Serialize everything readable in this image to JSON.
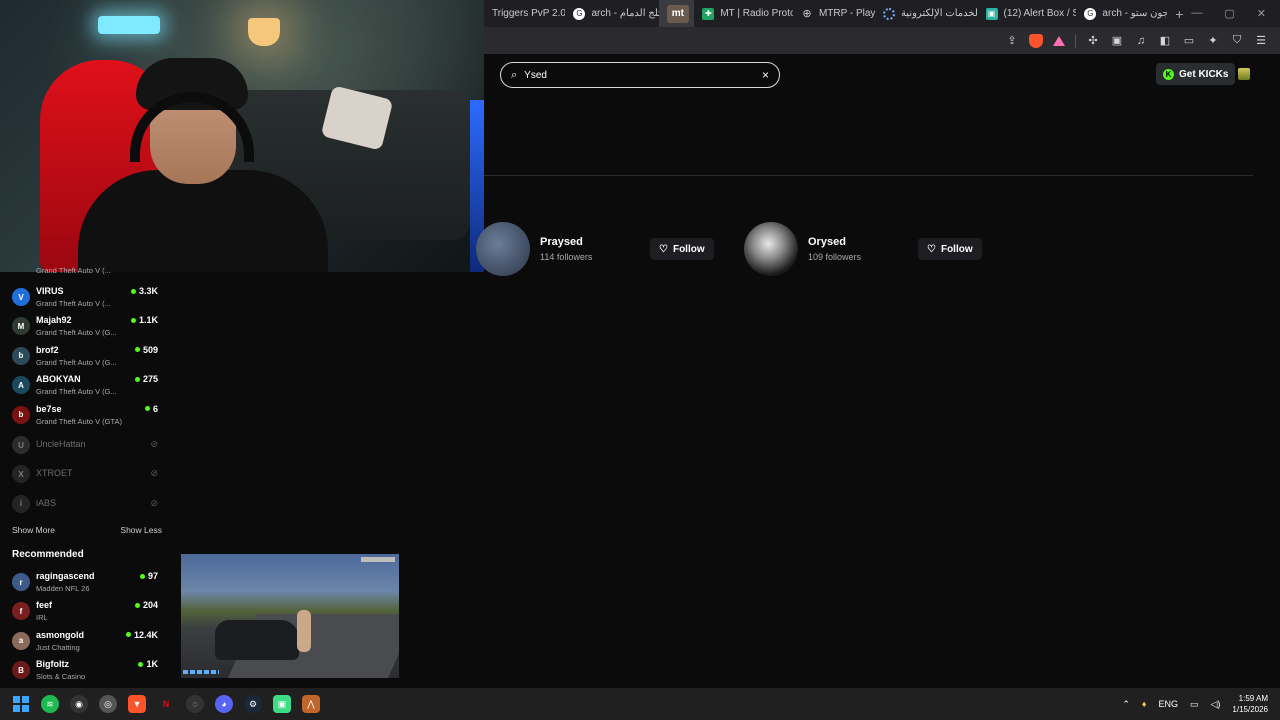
{
  "browser": {
    "tabs": [
      {
        "label": "Triggers PvP 2.0",
        "icon": "none"
      },
      {
        "label": "arch - ثلج الدمام",
        "icon": "google-icon"
      },
      {
        "label": "mt",
        "icon": "mt-icon"
      },
      {
        "label": "MT | Radio Proto",
        "icon": "sheets-icon"
      },
      {
        "label": "MTRP - Play",
        "icon": "globe-icon"
      },
      {
        "label": "الخدمات الإلكترونية",
        "icon": "loading-icon"
      },
      {
        "label": "(12) Alert Box / S",
        "icon": "alertbox-icon"
      },
      {
        "label": "arch - جون ستو",
        "icon": "google-icon"
      }
    ],
    "new_tab": "+"
  },
  "search": {
    "value": "Ysed",
    "clear": "×"
  },
  "header": {
    "get_kicks": "Get KICKs"
  },
  "results": [
    {
      "name": "Praysed",
      "followers": "114 followers",
      "follow": "Follow"
    },
    {
      "name": "Orysed",
      "followers": "109 followers",
      "follow": "Follow"
    }
  ],
  "sidebar": {
    "top_partial_game": "Grand Theft Auto V (...",
    "following": [
      {
        "name": "VIRUS",
        "game": "Grand Theft Auto V (...",
        "viewers": "3.3K",
        "avatar": "V",
        "color": "#1e6fd9"
      },
      {
        "name": "Majah92",
        "game": "Grand Theft Auto V (G...",
        "viewers": "1.1K",
        "avatar": "M",
        "color": "#2f3a30"
      },
      {
        "name": "brof2",
        "game": "Grand Theft Auto V (G...",
        "viewers": "509",
        "avatar": "b",
        "color": "#2c4a5a"
      },
      {
        "name": "ABOKYAN",
        "game": "Grand Theft Auto V (G...",
        "viewers": "275",
        "avatar": "A",
        "color": "#1b4a5e"
      },
      {
        "name": "be7se",
        "game": "Grand Theft Auto V (GTA)",
        "viewers": "6",
        "avatar": "b",
        "color": "#7a1212"
      }
    ],
    "offline": [
      {
        "name": "UncleHattan",
        "avatar": "U",
        "color": "#555"
      },
      {
        "name": "XTROET",
        "avatar": "X",
        "color": "#444"
      },
      {
        "name": "iABS",
        "avatar": "i",
        "color": "#444"
      }
    ],
    "show_more": "Show More",
    "show_less": "Show Less",
    "recommended_title": "Recommended",
    "recommended": [
      {
        "name": "ragingascend",
        "game": "Madden NFL 26",
        "viewers": "97",
        "avatar": "r",
        "color": "#3d5a8a"
      },
      {
        "name": "feef",
        "game": "IRL",
        "viewers": "204",
        "avatar": "f",
        "color": "#7a1f1f"
      },
      {
        "name": "asmongold",
        "game": "Just Chatting",
        "viewers": "12.4K",
        "avatar": "a",
        "color": "#8a6a5a"
      },
      {
        "name": "Bigfoltz",
        "game": "Slots & Casino",
        "viewers": "1K",
        "avatar": "B",
        "color": "#6a1a1a"
      }
    ]
  },
  "taskbar": {
    "lang": "ENG",
    "time": "1:59 AM",
    "date": "1/15/2026",
    "apps": [
      "windows-icon",
      "spotify-icon",
      "obs-icon",
      "chrome-icon",
      "brave-icon",
      "netflix-icon",
      "epic-icon",
      "discord-icon",
      "steam-icon",
      "app-icon",
      "kick-icon"
    ]
  }
}
